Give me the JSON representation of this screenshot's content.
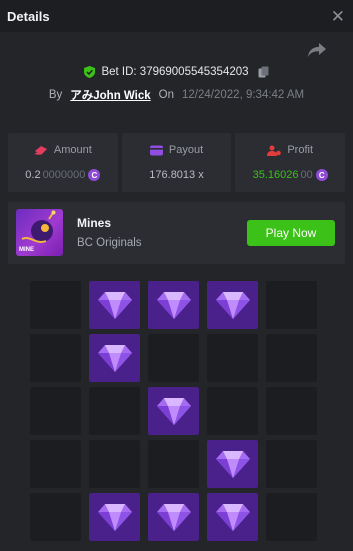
{
  "header": {
    "title": "Details"
  },
  "bet": {
    "id_label": "Bet ID: 37969005545354203",
    "by_label": "By",
    "user": "アみJohn Wick",
    "on_label": "On",
    "timestamp": "12/24/2022, 9:34:42 AM"
  },
  "stats": {
    "amount": {
      "label": "Amount",
      "value_main": "0.2",
      "value_dim": "0000000",
      "icon": "money-wings-icon",
      "color": "#e23c5e"
    },
    "payout": {
      "label": "Payout",
      "value": "176.8013 x",
      "icon": "wallet-icon",
      "color": "#8f4ee0"
    },
    "profit": {
      "label": "Profit",
      "value_main": "35.16026",
      "value_dim": "00",
      "icon": "user-coin-icon",
      "color": "#e23c3c"
    }
  },
  "coin_symbol": "C",
  "game": {
    "name": "Mines",
    "provider": "BC Originals",
    "thumb_label": "MINE",
    "play_label": "Play Now",
    "accent": "#3bc117"
  },
  "mines_grid": {
    "rows": 5,
    "cols": 5,
    "cells": [
      [
        "empty",
        "gem",
        "gem",
        "gem",
        "empty"
      ],
      [
        "empty",
        "gem",
        "empty",
        "empty",
        "empty"
      ],
      [
        "empty",
        "empty",
        "gem",
        "empty",
        "empty"
      ],
      [
        "empty",
        "empty",
        "empty",
        "gem",
        "empty"
      ],
      [
        "empty",
        "gem",
        "gem",
        "gem",
        "empty"
      ]
    ]
  }
}
